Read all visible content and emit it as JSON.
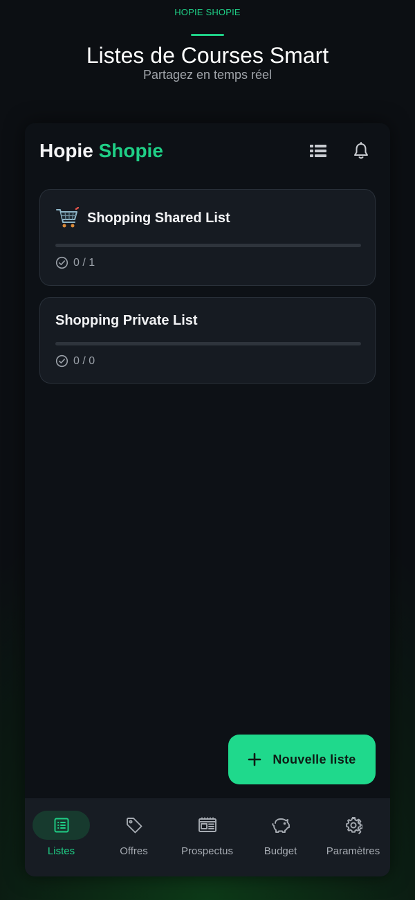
{
  "page": {
    "eyebrow": "HOPIE SHOPIE",
    "title": "Listes de Courses Smart",
    "subtitle": "Partagez en temps réel"
  },
  "header": {
    "brand_part1": "Hopie",
    "brand_part2": "Shopie",
    "icons": [
      "list-view-icon",
      "bell-icon"
    ]
  },
  "lists": [
    {
      "title": "Shopping Shared List",
      "icon": "shopping-cart-icon",
      "count": "0 / 1",
      "progress": 0
    },
    {
      "title": "Shopping Private List",
      "count": "0 / 0",
      "progress": 0
    }
  ],
  "fab": {
    "label": "Nouvelle liste",
    "icon": "plus-icon"
  },
  "nav": {
    "items": [
      {
        "label": "Listes",
        "icon": "list-icon",
        "active": true
      },
      {
        "label": "Offres",
        "icon": "tag-icon",
        "active": false
      },
      {
        "label": "Prospectus",
        "icon": "newspaper-icon",
        "active": false
      },
      {
        "label": "Budget",
        "icon": "piggy-bank-icon",
        "active": false
      },
      {
        "label": "Paramètres",
        "icon": "gear-icon",
        "active": false
      }
    ]
  },
  "colors": {
    "accent": "#1fcf86",
    "background": "#0d1116",
    "card": "#161b22"
  }
}
